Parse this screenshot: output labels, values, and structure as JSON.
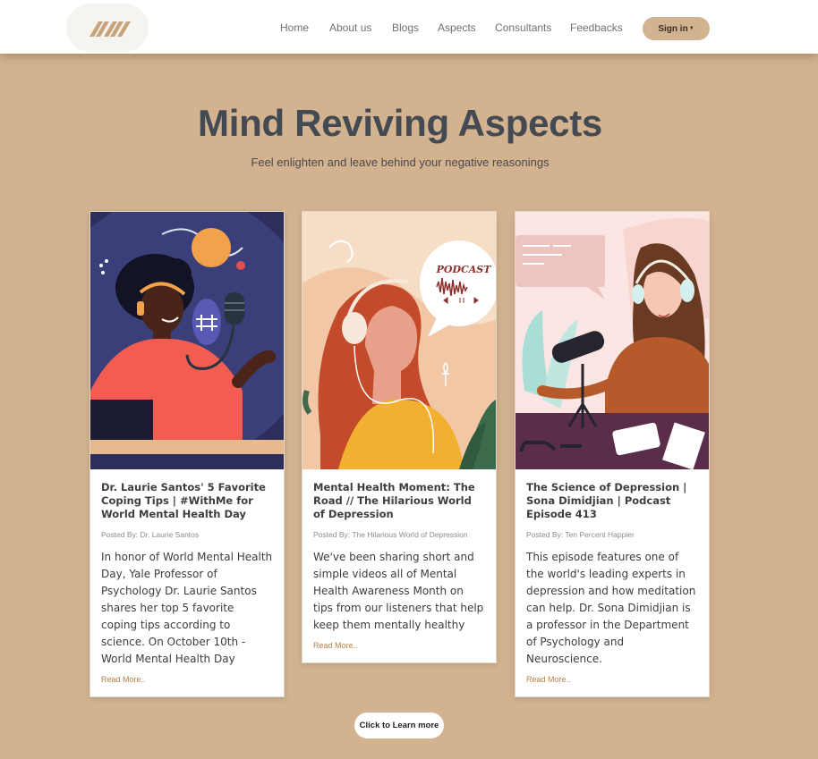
{
  "nav": {
    "items": [
      {
        "label": "Home"
      },
      {
        "label": "About us"
      },
      {
        "label": "Blogs"
      },
      {
        "label": "Aspects"
      },
      {
        "label": "Consultants"
      },
      {
        "label": "Feedbacks"
      }
    ],
    "signin_label": "Sign in"
  },
  "hero": {
    "title": "Mind Reviving Aspects",
    "subtitle": "Feel enlighten and leave behind your negative reasonings"
  },
  "cards": [
    {
      "title": "Dr. Laurie Santos' 5 Favorite Coping Tips | #WithMe for World Mental Health Day",
      "author": "Posted By: Dr. Laurie Santos",
      "text": "In honor of World Mental Health Day, Yale Professor of Psychology Dr. Laurie Santos shares her top 5 favorite coping tips according to science. On October 10th - World Mental Health Day",
      "link": "Read More.."
    },
    {
      "title": "Mental Health Moment: The Road // The Hilarious World of Depression",
      "author": "Posted By: The Hilarious World of Depression",
      "text": "We've been sharing short and simple videos all of Mental Health Awareness Month on tips from our listeners that help keep them mentally healthy",
      "link": "Read More..",
      "podcast_label": "PODCAST"
    },
    {
      "title": "The Science of Depression | Sona Dimidjian | Podcast Episode 413",
      "author": "Posted By: Ten Percent Happier",
      "text": "This episode features one of the world's leading experts in depression and how meditation can help. Dr. Sona Dimidjian is a professor in the Department of Psychology and Neuroscience.",
      "link": "Read More.."
    }
  ],
  "cta": {
    "label": "Click to Learn more"
  }
}
